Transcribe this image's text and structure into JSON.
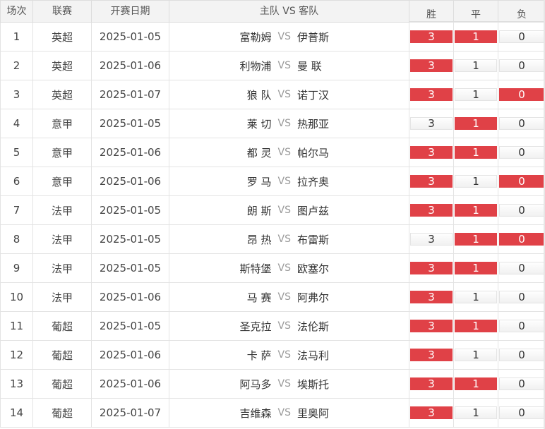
{
  "headers": {
    "round": "场次",
    "league": "联赛",
    "date": "开赛日期",
    "match": "主队 VS 客队",
    "win": "胜",
    "draw": "平",
    "lose": "负"
  },
  "vs_label": "VS",
  "colors": {
    "selected": "#e04147",
    "unselected_bg": "#f5f5f5"
  },
  "matches": [
    {
      "no": "1",
      "league": "英超",
      "date": "2025-01-05",
      "home": "富勒姆",
      "away": "伊普斯",
      "win": "3",
      "draw": "1",
      "lose": "0",
      "sel": [
        true,
        true,
        false
      ]
    },
    {
      "no": "2",
      "league": "英超",
      "date": "2025-01-06",
      "home": "利物浦",
      "away": "曼 联",
      "win": "3",
      "draw": "1",
      "lose": "0",
      "sel": [
        true,
        false,
        false
      ]
    },
    {
      "no": "3",
      "league": "英超",
      "date": "2025-01-07",
      "home": "狼 队",
      "away": "诺丁汉",
      "win": "3",
      "draw": "1",
      "lose": "0",
      "sel": [
        true,
        false,
        true
      ]
    },
    {
      "no": "4",
      "league": "意甲",
      "date": "2025-01-05",
      "home": "莱 切",
      "away": "热那亚",
      "win": "3",
      "draw": "1",
      "lose": "0",
      "sel": [
        false,
        true,
        false
      ]
    },
    {
      "no": "5",
      "league": "意甲",
      "date": "2025-01-06",
      "home": "都 灵",
      "away": "帕尔马",
      "win": "3",
      "draw": "1",
      "lose": "0",
      "sel": [
        true,
        true,
        false
      ]
    },
    {
      "no": "6",
      "league": "意甲",
      "date": "2025-01-06",
      "home": "罗 马",
      "away": "拉齐奥",
      "win": "3",
      "draw": "1",
      "lose": "0",
      "sel": [
        true,
        false,
        true
      ]
    },
    {
      "no": "7",
      "league": "法甲",
      "date": "2025-01-05",
      "home": "朗 斯",
      "away": "图卢兹",
      "win": "3",
      "draw": "1",
      "lose": "0",
      "sel": [
        true,
        true,
        false
      ]
    },
    {
      "no": "8",
      "league": "法甲",
      "date": "2025-01-05",
      "home": "昂 热",
      "away": "布雷斯",
      "win": "3",
      "draw": "1",
      "lose": "0",
      "sel": [
        false,
        true,
        true
      ]
    },
    {
      "no": "9",
      "league": "法甲",
      "date": "2025-01-05",
      "home": "斯特堡",
      "away": "欧塞尔",
      "win": "3",
      "draw": "1",
      "lose": "0",
      "sel": [
        true,
        true,
        false
      ]
    },
    {
      "no": "10",
      "league": "法甲",
      "date": "2025-01-06",
      "home": "马 赛",
      "away": "阿弗尔",
      "win": "3",
      "draw": "1",
      "lose": "0",
      "sel": [
        true,
        false,
        false
      ]
    },
    {
      "no": "11",
      "league": "葡超",
      "date": "2025-01-05",
      "home": "圣克拉",
      "away": "法伦斯",
      "win": "3",
      "draw": "1",
      "lose": "0",
      "sel": [
        true,
        true,
        false
      ]
    },
    {
      "no": "12",
      "league": "葡超",
      "date": "2025-01-06",
      "home": "卡 萨",
      "away": "法马利",
      "win": "3",
      "draw": "1",
      "lose": "0",
      "sel": [
        true,
        false,
        false
      ]
    },
    {
      "no": "13",
      "league": "葡超",
      "date": "2025-01-06",
      "home": "阿马多",
      "away": "埃斯托",
      "win": "3",
      "draw": "1",
      "lose": "0",
      "sel": [
        true,
        true,
        false
      ]
    },
    {
      "no": "14",
      "league": "葡超",
      "date": "2025-01-07",
      "home": "吉维森",
      "away": "里奥阿",
      "win": "3",
      "draw": "1",
      "lose": "0",
      "sel": [
        true,
        false,
        false
      ]
    }
  ]
}
